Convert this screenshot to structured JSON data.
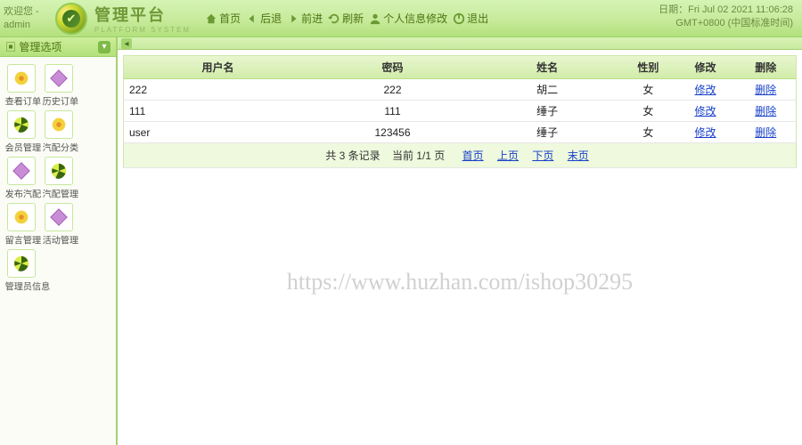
{
  "header": {
    "welcome_prefix": "欢迎您 -",
    "username": "admin",
    "brand_title": "管理平台",
    "brand_sub": "PLATFORM SYSTEM",
    "nav": [
      {
        "label": "首页",
        "icon": "home-icon"
      },
      {
        "label": "后退",
        "icon": "back-icon"
      },
      {
        "label": "前进",
        "icon": "forward-icon"
      },
      {
        "label": "刷新",
        "icon": "refresh-icon"
      },
      {
        "label": "个人信息修改",
        "icon": "user-edit-icon"
      },
      {
        "label": "退出",
        "icon": "exit-icon"
      }
    ],
    "date_label": "日期：",
    "date_value": "Fri Jul 02 2021 11:06:28",
    "tz": "GMT+0800 (中国标准时间)"
  },
  "sidebar": {
    "title": "管理选项",
    "items": [
      {
        "label": "查看订单"
      },
      {
        "label": "历史订单"
      },
      {
        "label": "会员管理"
      },
      {
        "label": "汽配分类"
      },
      {
        "label": "发布汽配"
      },
      {
        "label": "汽配管理"
      },
      {
        "label": "留言管理"
      },
      {
        "label": "活动管理"
      },
      {
        "label": "管理员信息"
      }
    ]
  },
  "table": {
    "columns": [
      "用户名",
      "密码",
      "姓名",
      "性别",
      "修改",
      "删除"
    ],
    "rows": [
      {
        "user": "222",
        "pwd": "222",
        "name": "胡二",
        "sex": "女",
        "edit": "修改",
        "del": "删除"
      },
      {
        "user": "111",
        "pwd": "111",
        "name": "缍子",
        "sex": "女",
        "edit": "修改",
        "del": "删除"
      },
      {
        "user": "user",
        "pwd": "123456",
        "name": "缍子",
        "sex": "女",
        "edit": "修改",
        "del": "删除"
      }
    ],
    "pager": {
      "total_text": "共 3 条记录",
      "current_text": "当前 1/1 页",
      "first": "首页",
      "prev": "上页",
      "next": "下页",
      "last": "末页"
    }
  },
  "watermark": "https://www.huzhan.com/ishop30295",
  "colors": {
    "accent": "#a6d170",
    "link": "#1740c9"
  }
}
